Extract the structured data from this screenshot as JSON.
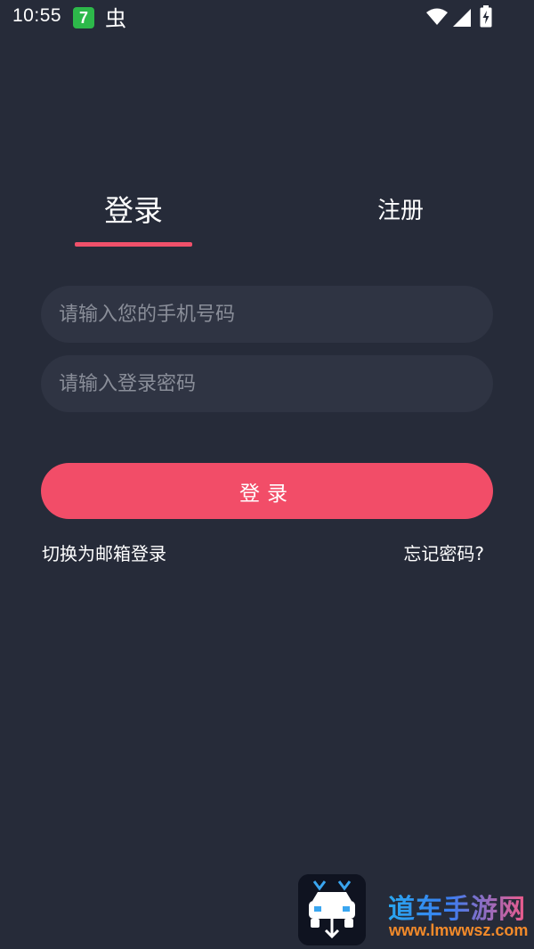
{
  "status_bar": {
    "time": "10:55",
    "notification_badge": "7",
    "icons": [
      "seven-app-icon",
      "bug-icon",
      "wifi-icon",
      "signal-icon",
      "battery-charging-icon"
    ]
  },
  "tabs": {
    "login_label": "登录",
    "register_label": "注册",
    "active": "login"
  },
  "form": {
    "phone_placeholder": "请输入您的手机号码",
    "phone_value": "",
    "password_placeholder": "请输入登录密码",
    "password_value": "",
    "login_button_label": "登录"
  },
  "links": {
    "switch_email": "切换为邮箱登录",
    "forgot_password": "忘记密码?"
  },
  "watermark": {
    "title": "道车手游网",
    "url": "www.lmwwsz.com"
  },
  "colors": {
    "background": "#262b39",
    "accent": "#f24d68",
    "input_bg": "#2f3443",
    "placeholder": "#8a8e99"
  }
}
